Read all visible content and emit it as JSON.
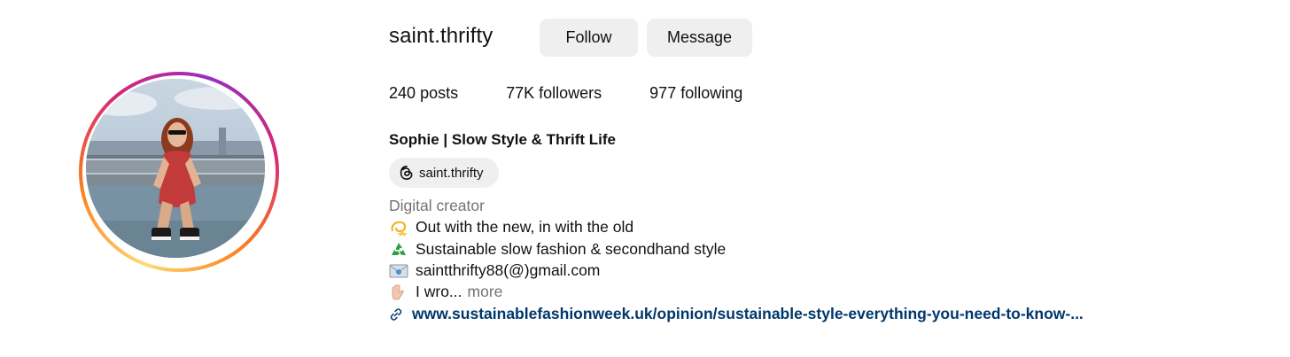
{
  "profile": {
    "username": "saint.thrifty",
    "follow_label": "Follow",
    "message_label": "Message",
    "stats": {
      "posts_count": "240",
      "posts_label": "posts",
      "followers_count": "77K",
      "followers_label": "followers",
      "following_count": "977",
      "following_label": "following"
    },
    "full_name": "Sophie | Slow Style & Thrift Life",
    "threads_handle": "saint.thrifty",
    "category": "Digital creator",
    "bio": [
      {
        "icon": "dizzy-icon",
        "text": "Out with the new, in with the old"
      },
      {
        "icon": "recycle-icon",
        "text": "Sustainable slow fashion & secondhand style"
      },
      {
        "icon": "email-icon",
        "text": "saintthrifty88(@)gmail.com"
      },
      {
        "icon": "pointing-down-icon",
        "text": "I wro...",
        "more": "more"
      }
    ],
    "link": "www.sustainablefashionweek.uk/opinion/sustainable-style-everything-you-need-to-know-..."
  },
  "colors": {
    "button_bg": "#efefef",
    "link": "#00376b",
    "secondary_text": "#737373"
  }
}
